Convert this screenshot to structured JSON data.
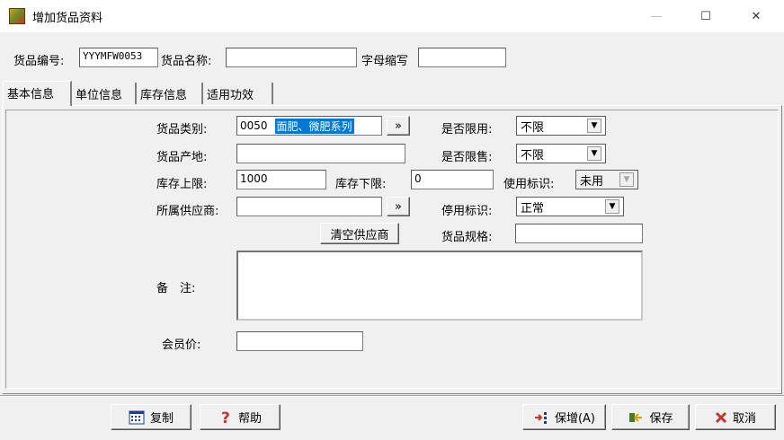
{
  "window": {
    "title": "增加货品资料",
    "minimize": "—",
    "maximize": "☐",
    "close": "✕"
  },
  "header": {
    "code_label": "货品编号:",
    "code_value": "YYYMFW0053",
    "name_label": "货品名称:",
    "name_value": "",
    "abbr_label": "字母缩写",
    "abbr_value": ""
  },
  "tabs": [
    {
      "label": "基本信息",
      "active": true
    },
    {
      "label": "单位信息",
      "active": false
    },
    {
      "label": "库存信息",
      "active": false
    },
    {
      "label": "适用功效",
      "active": false
    }
  ],
  "form": {
    "category_label": "货品类别:",
    "category_code": "0050",
    "category_name": "面肥、微肥系列",
    "browse": "»",
    "limit_use_label": "是否限用:",
    "limit_use_value": "不限",
    "origin_label": "货品产地:",
    "origin_value": "",
    "limit_sale_label": "是否限售:",
    "limit_sale_value": "不限",
    "stock_upper_label": "库存上限:",
    "stock_upper_value": "1000",
    "stock_lower_label": "库存下限:",
    "stock_lower_value": "0",
    "use_flag_label": "使用标识:",
    "use_flag_value": "未用",
    "supplier_label": "所属供应商:",
    "supplier_value": "",
    "disable_flag_label": "停用标识:",
    "disable_flag_value": "正常",
    "clear_supplier": "清空供应商",
    "spec_label": "货品规格:",
    "spec_value": "",
    "remark_label": "备　注:",
    "remark_value": "",
    "member_price_label": "会员价:",
    "member_price_value": ""
  },
  "footer": {
    "copy": "复制",
    "help": "帮助",
    "save_add": "保增(A)",
    "save": "保存",
    "cancel": "取消"
  }
}
